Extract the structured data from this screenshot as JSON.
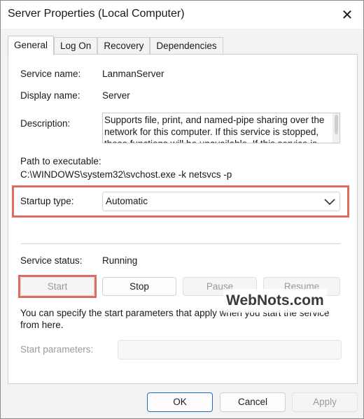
{
  "window": {
    "title": "Server Properties (Local Computer)",
    "close_glyph": "✕"
  },
  "tabs": [
    {
      "label": "General",
      "active": true
    },
    {
      "label": "Log On",
      "active": false
    },
    {
      "label": "Recovery",
      "active": false
    },
    {
      "label": "Dependencies",
      "active": false
    }
  ],
  "general": {
    "service_name_label": "Service name:",
    "service_name_value": "LanmanServer",
    "display_name_label": "Display name:",
    "display_name_value": "Server",
    "description_label": "Description:",
    "description_value": "Supports file, print, and named-pipe sharing over the network for this computer. If this service is stopped, these functions will be unavailable. If this service is",
    "path_label": "Path to executable:",
    "path_value": "C:\\WINDOWS\\system32\\svchost.exe -k netsvcs -p",
    "startup_type_label": "Startup type:",
    "startup_type_value": "Automatic",
    "service_status_label": "Service status:",
    "service_status_value": "Running",
    "buttons": {
      "start": "Start",
      "stop": "Stop",
      "pause": "Pause",
      "resume": "Resume"
    },
    "params_hint": "You can specify the start parameters that apply when you start the service from here.",
    "params_label": "Start parameters:",
    "params_value": ""
  },
  "footer": {
    "ok": "OK",
    "cancel": "Cancel",
    "apply": "Apply"
  },
  "watermark": "WebNots.com",
  "colors": {
    "highlight": "#e06b60",
    "primary_border": "#1a6fc4"
  }
}
